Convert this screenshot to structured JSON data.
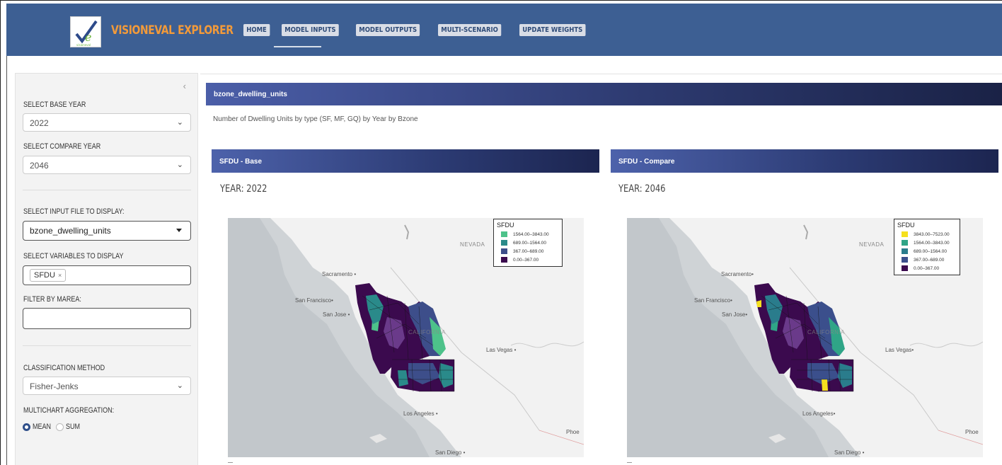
{
  "header": {
    "app_title": "VISIONEVAL EXPLORER",
    "logo_icon": "visioneval-logo-icon",
    "nav": [
      {
        "label": "HOME",
        "active": false
      },
      {
        "label": "MODEL INPUTS",
        "active": true
      },
      {
        "label": "MODEL OUTPUTS",
        "active": false
      },
      {
        "label": "MULTI-SCENARIO",
        "active": false
      },
      {
        "label": "UPDATE WEIGHTS",
        "active": false
      }
    ],
    "colors": {
      "bar": "#3d5f93",
      "title": "#f29a3a"
    }
  },
  "sidebar": {
    "collapse_icon": "chevron-left-icon",
    "base_year_label": "SELECT BASE YEAR",
    "base_year_value": "2022",
    "compare_year_label": "SELECT COMPARE YEAR",
    "compare_year_value": "2046",
    "input_file_label": "SELECT INPUT FILE TO DISPLAY:",
    "input_file_value": "bzone_dwelling_units",
    "variables_label": "SELECT VARIABLES TO DISPLAY",
    "variables_tags": [
      "SFDU"
    ],
    "marea_label": "FILTER BY MAREA:",
    "marea_value": "",
    "classification_label": "CLASSIFICATION METHOD",
    "classification_value": "Fisher-Jenks",
    "aggregation_label": "MULTICHART AGGREGATION:",
    "aggregation_options": [
      "MEAN",
      "SUM"
    ],
    "aggregation_selected": "MEAN"
  },
  "main": {
    "panel_title": "bzone_dwelling_units",
    "description": "Number of Dwelling Units by type (SF, MF, GQ) by Year by Bzone",
    "cards": [
      {
        "title": "SFDU - Base",
        "year_text": "YEAR: 2022",
        "legend": {
          "title": "SFDU",
          "items": [
            {
              "label": "1564.00–3843.00",
              "color": "#4dc28a"
            },
            {
              "label": "689.00–1564.00",
              "color": "#2a8a8a"
            },
            {
              "label": "367.00–689.00",
              "color": "#3d4e8a"
            },
            {
              "label": "0.00–367.00",
              "color": "#3b0a4e"
            }
          ]
        },
        "map_labels": {
          "nevada": "NEVADA",
          "california": "CALIFORNIA",
          "sacramento": "Sacramento",
          "san_francisco": "San Francisco",
          "san_jose": "San Jose",
          "las_vegas": "Las Vegas",
          "los_angeles": "Los Angeles",
          "phoenix": "Phoe",
          "san_diego": "San Diego"
        }
      },
      {
        "title": "SFDU - Compare",
        "year_text": "YEAR: 2046",
        "legend": {
          "title": "SFDU",
          "items": [
            {
              "label": "3843.00–7523.00",
              "color": "#f5e01e"
            },
            {
              "label": "1564.00–3843.00",
              "color": "#2fa587"
            },
            {
              "label": "689.00–1564.00",
              "color": "#2a7c8c"
            },
            {
              "label": "367.00–689.00",
              "color": "#3b4f8c"
            },
            {
              "label": "0.00–367.00",
              "color": "#3b0a4e"
            }
          ]
        },
        "map_labels": {
          "nevada": "NEVADA",
          "california": "CALIFORNIA",
          "sacramento": "Sacramento",
          "san_francisco": "San Francisco",
          "san_jose": "San Jose",
          "las_vegas": "Las Vegas",
          "los_angeles": "Los Angeles",
          "phoenix": "Phoe",
          "san_diego": "San Diego"
        }
      }
    ]
  }
}
